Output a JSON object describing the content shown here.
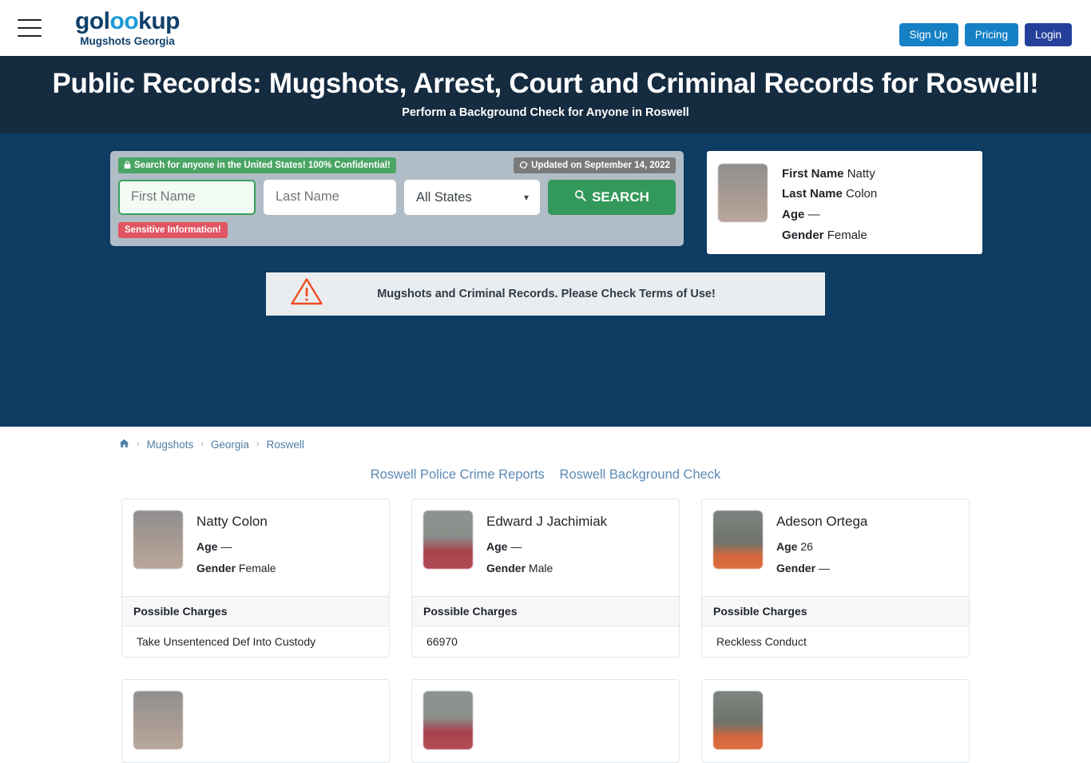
{
  "nav": {
    "menu_icon": "hamburger-icon",
    "brand_left": "gol",
    "brand_mid": "oo",
    "brand_right": "kup",
    "brand_sub": "Mugshots Georgia",
    "signup_label": "Sign Up",
    "pricing_label": "Pricing",
    "login_label": "Login",
    "colors": {
      "brand_dark": "#10406b",
      "brand_light": "#1c9ad6",
      "signup_bg": "#1580c4",
      "pricing_bg": "#1580c4",
      "login_bg": "#25409a"
    }
  },
  "hero": {
    "title": "Public Records: Mugshots, Arrest, Court and Criminal Records for Roswell!",
    "subtitle": "Perform a Background Check for Anyone in Roswell",
    "bg": "#152b40"
  },
  "search": {
    "section_bg": "#0e3c63",
    "confidential_badge": "Search for anyone in the United States! 100% Confidential!",
    "confidential_icon": "lock-icon",
    "updated_badge": "Updated on September 14, 2022",
    "updated_icon": "sync-icon",
    "first_name_placeholder": "First Name",
    "first_name_value": "",
    "last_name_placeholder": "Last Name",
    "last_name_value": "",
    "state_selected": "All States",
    "state_options": [
      "All States"
    ],
    "search_label": "SEARCH",
    "search_icon": "magnifier-icon",
    "sensitive_badge": "Sensitive Information!",
    "badge_green": "#4aa564",
    "badge_gray": "#7a7a7a",
    "badge_red": "#e05561",
    "search_btn_bg": "#33995b"
  },
  "featured": {
    "avatar": "mugshot-thumbnail",
    "first_name_label": "First Name",
    "first_name_value": "Natty",
    "last_name_label": "Last Name",
    "last_name_value": "Colon",
    "age_label": "Age",
    "age_value": "—",
    "gender_label": "Gender",
    "gender_value": "Female"
  },
  "warning": {
    "icon": "warning-triangle-icon",
    "text": "Mugshots and Criminal Records. Please Check Terms of Use!",
    "bg": "#e9edf0",
    "icon_color": "#f04e23"
  },
  "breadcrumb": {
    "home_icon": "home-icon",
    "items": [
      "Mugshots",
      "Georgia",
      "Roswell"
    ],
    "separator": "›"
  },
  "quicklinks": [
    {
      "label": "Roswell Police Crime Reports"
    },
    {
      "label": "Roswell Background Check"
    }
  ],
  "results": {
    "charges_header": "Possible Charges",
    "age_label": "Age",
    "gender_label": "Gender",
    "cards": [
      {
        "name": "Natty Colon",
        "age": "—",
        "gender": "Female",
        "charge": "Take Unsentenced Def Into Custody",
        "avatar": "mugshot-thumbnail"
      },
      {
        "name": "Edward J Jachimiak",
        "age": "—",
        "gender": "Male",
        "charge": "66970",
        "avatar": "mugshot-thumbnail"
      },
      {
        "name": "Adeson Ortega",
        "age": "26",
        "gender": "—",
        "charge": "Reckless Conduct",
        "avatar": "mugshot-thumbnail"
      }
    ]
  }
}
